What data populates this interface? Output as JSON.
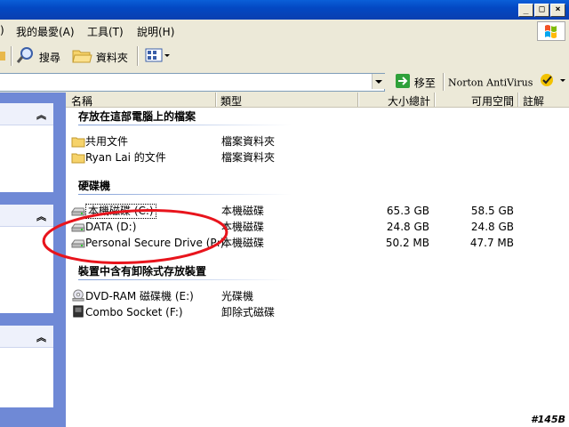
{
  "menu": {
    "favorites": "我的最愛(A)",
    "tools": "工具(T)",
    "help": "說明(H)"
  },
  "toolbar": {
    "search": "搜尋",
    "folders": "資料夾"
  },
  "addressbar": {
    "go": "移至",
    "norton": "Norton AntiVirus"
  },
  "columns": {
    "name": "名稱",
    "type": "類型",
    "total": "大小總計",
    "free": "可用空間",
    "comment": "註解"
  },
  "groups": {
    "stored": "存放在這部電腦上的檔案",
    "hdd": "硬碟機",
    "removable": "裝置中含有卸除式存放裝置"
  },
  "files": [
    {
      "name": "共用文件",
      "type": "檔案資料夾",
      "icon": "folder-icon"
    },
    {
      "name": "Ryan Lai 的文件",
      "type": "檔案資料夾",
      "icon": "folder-icon"
    }
  ],
  "drives": [
    {
      "name": "本機磁碟 (C:)",
      "type": "本機磁碟",
      "total": "65.3 GB",
      "free": "58.5 GB",
      "icon": "hard-drive-icon"
    },
    {
      "name": "DATA (D:)",
      "type": "本機磁碟",
      "total": "24.8 GB",
      "free": "24.8 GB",
      "icon": "hard-drive-icon"
    },
    {
      "name": "Personal Secure Drive (P:)",
      "type": "本機磁碟",
      "total": "50.2 MB",
      "free": "47.7 MB",
      "icon": "hard-drive-icon"
    }
  ],
  "removable": [
    {
      "name": "DVD-RAM 磁碟機 (E:)",
      "type": "光碟機",
      "icon": "dvd-drive-icon"
    },
    {
      "name": "Combo Socket (F:)",
      "type": "卸除式磁碟",
      "icon": "card-reader-icon"
    }
  ],
  "stamp": "#145B",
  "colors": {
    "annotation": "#e8141c",
    "titlebar": "#0a5fd8",
    "sidepane": "#6f89d6"
  }
}
